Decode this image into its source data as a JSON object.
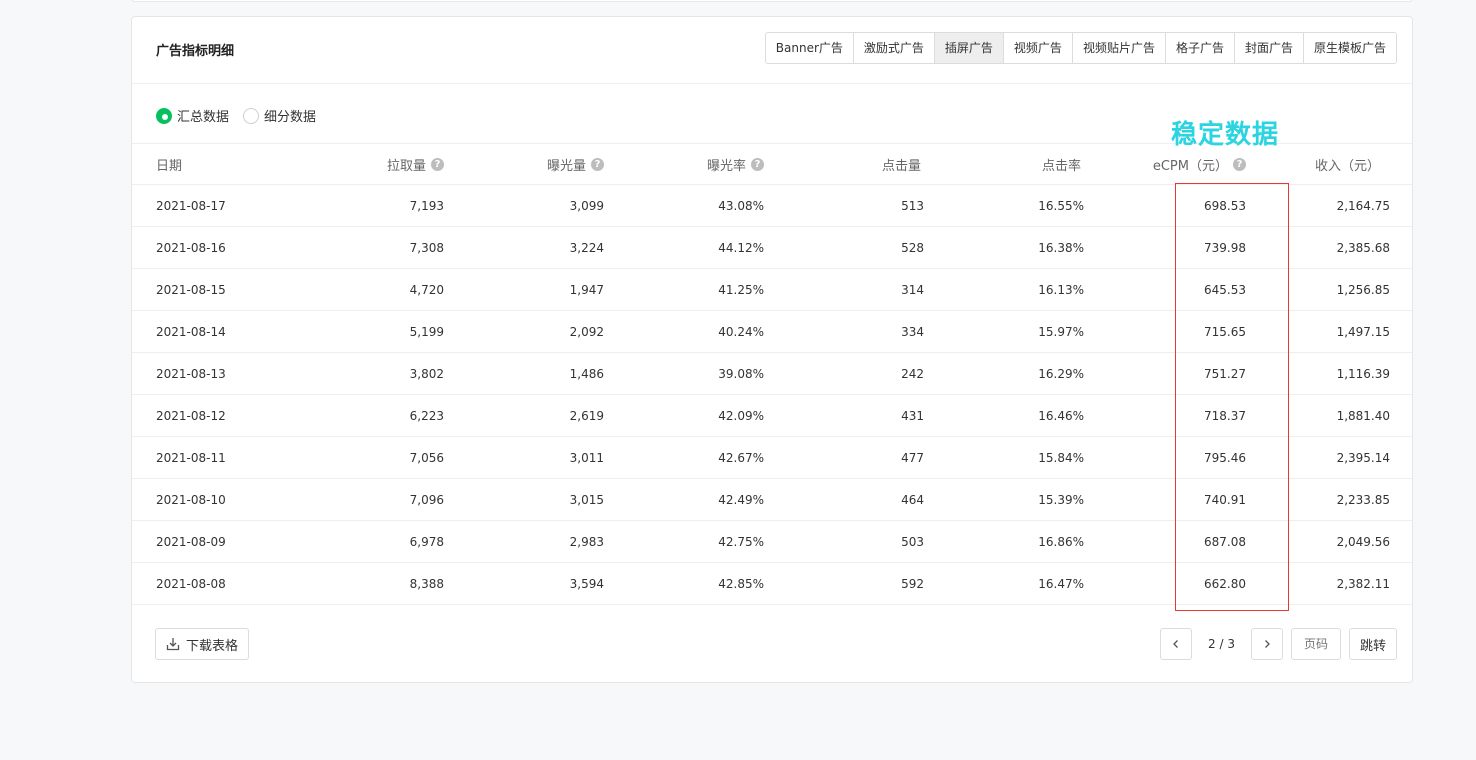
{
  "card": {
    "title": "广告指标明细",
    "tabs": [
      "Banner广告",
      "激励式广告",
      "插屏广告",
      "视频广告",
      "视频贴片广告",
      "格子广告",
      "封面广告",
      "原生模板广告"
    ],
    "active_tab": "插屏广告"
  },
  "radios": {
    "summary": "汇总数据",
    "detail": "细分数据",
    "selected": "汇总数据"
  },
  "overlay_label": "稳定数据",
  "table": {
    "headers": [
      "日期",
      "拉取量",
      "曝光量",
      "曝光率",
      "点击量",
      "点击率",
      "eCPM（元）",
      "收入（元）"
    ],
    "rows": [
      [
        "2021-08-17",
        "7,193",
        "3,099",
        "43.08%",
        "513",
        "16.55%",
        "698.53",
        "2,164.75"
      ],
      [
        "2021-08-16",
        "7,308",
        "3,224",
        "44.12%",
        "528",
        "16.38%",
        "739.98",
        "2,385.68"
      ],
      [
        "2021-08-15",
        "4,720",
        "1,947",
        "41.25%",
        "314",
        "16.13%",
        "645.53",
        "1,256.85"
      ],
      [
        "2021-08-14",
        "5,199",
        "2,092",
        "40.24%",
        "334",
        "15.97%",
        "715.65",
        "1,497.15"
      ],
      [
        "2021-08-13",
        "3,802",
        "1,486",
        "39.08%",
        "242",
        "16.29%",
        "751.27",
        "1,116.39"
      ],
      [
        "2021-08-12",
        "6,223",
        "2,619",
        "42.09%",
        "431",
        "16.46%",
        "718.37",
        "1,881.40"
      ],
      [
        "2021-08-11",
        "7,056",
        "3,011",
        "42.67%",
        "477",
        "15.84%",
        "795.46",
        "2,395.14"
      ],
      [
        "2021-08-10",
        "7,096",
        "3,015",
        "42.49%",
        "464",
        "15.39%",
        "740.91",
        "2,233.85"
      ],
      [
        "2021-08-09",
        "6,978",
        "2,983",
        "42.75%",
        "503",
        "16.86%",
        "687.08",
        "2,049.56"
      ],
      [
        "2021-08-08",
        "8,388",
        "3,594",
        "42.85%",
        "592",
        "16.47%",
        "662.80",
        "2,382.11"
      ]
    ]
  },
  "footer": {
    "download_label": "下载表格",
    "page_info": "2 / 3",
    "page_input_placeholder": "页码",
    "jump_label": "跳转"
  },
  "colors": {
    "accent_green": "#07c160",
    "highlight_red": "#e53935",
    "overlay_cyan": "#2ad4e0"
  }
}
